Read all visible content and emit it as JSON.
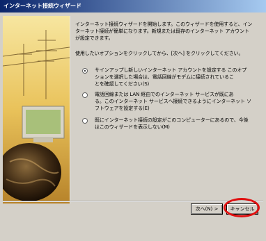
{
  "window": {
    "title": "インターネット接続ウィザード"
  },
  "intro": {
    "line1": "インターネット接続ウィザードを開始します。このウィザードを使用すると、イン",
    "line2": "ターネット接続が簡単になります。新規または既存のインターネット アカウント",
    "line3": "が設定できます。"
  },
  "instruction": "使用したいオプションをクリックしてから、[次へ] をクリックしてください。",
  "options": [
    {
      "selected": true,
      "line1": "サインアップし新しいインターネット アカウントを設定する このオプ",
      "line2": "ションを選択した場合は、電話回線がモデムに接続されているこ",
      "line3": "とを確認してください(S)"
    },
    {
      "selected": false,
      "line1": "電話回線または LAN 経由でのインターネット サービスが既にあ",
      "line2": "る。このインターネット サービスへ接続できるようにインターネット ソ",
      "line3": "フトウェアを設定する(E)"
    },
    {
      "selected": false,
      "line1": "既にインターネット接続の設定がこのコンピューターにあるので、今後",
      "line2": "はこのウィザードを表示しない(M)"
    }
  ],
  "buttons": {
    "next": "次へ(N) >",
    "cancel": "キャンセル"
  }
}
